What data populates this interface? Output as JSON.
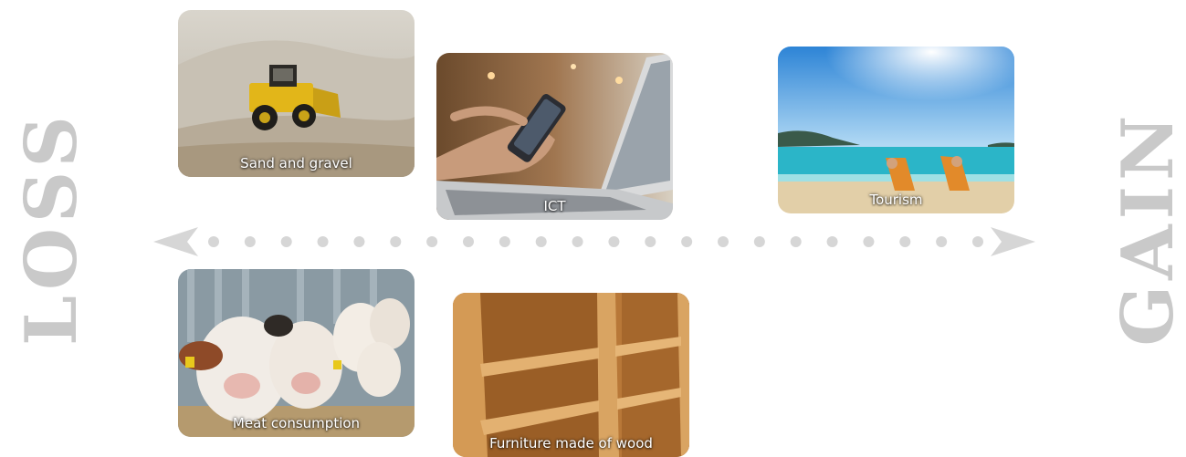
{
  "labels": {
    "loss": "LOSS",
    "gain": "GAIN"
  },
  "cards": {
    "sand": {
      "caption": "Sand and gravel"
    },
    "ict": {
      "caption": "ICT"
    },
    "tourism": {
      "caption": "Tourism"
    },
    "meat": {
      "caption": "Meat consumption"
    },
    "furniture": {
      "caption": "Furniture made of wood"
    }
  },
  "colors": {
    "axis": "#d6d6d6",
    "label": "#c9c9c9"
  }
}
